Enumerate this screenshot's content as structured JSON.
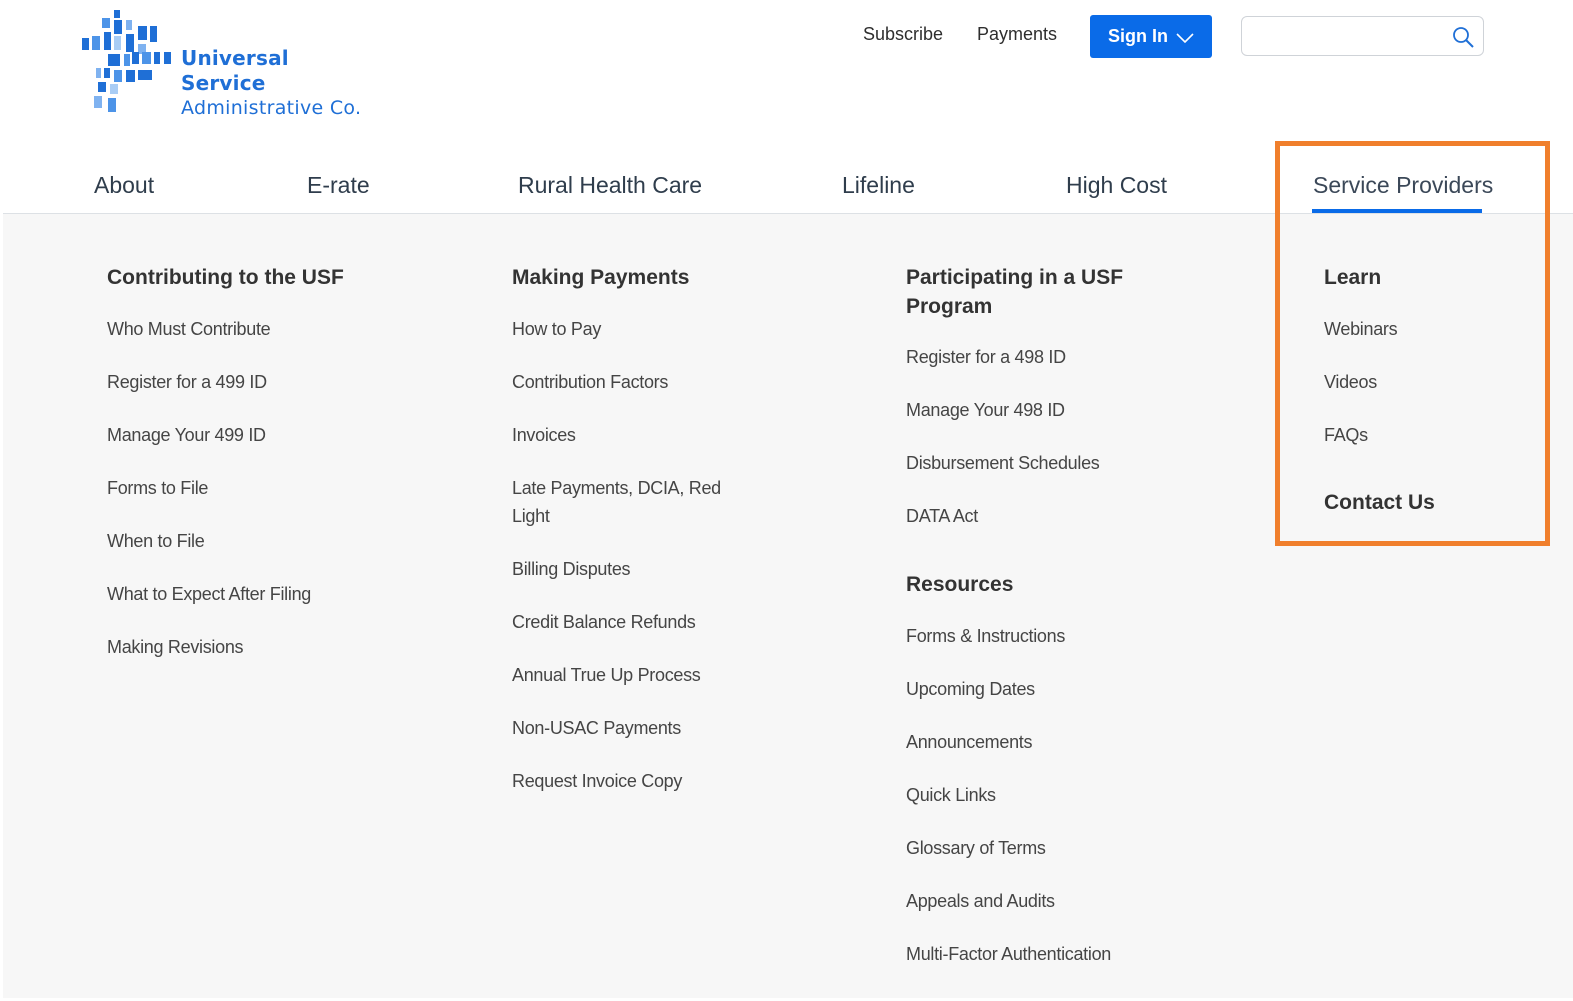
{
  "brand": {
    "name_line1": "Universal Service",
    "name_line2": "Administrative Co.",
    "color": "#1f6fd6"
  },
  "utility_nav": {
    "subscribe": "Subscribe",
    "payments": "Payments",
    "sign_in": "Sign In",
    "search_placeholder": ""
  },
  "main_nav": {
    "items": [
      "About",
      "E-rate",
      "Rural Health Care",
      "Lifeline",
      "High Cost",
      "Service Providers"
    ],
    "active": "Service Providers"
  },
  "mega_menu": {
    "contributing": {
      "heading": "Contributing to the USF",
      "links": [
        "Who Must Contribute",
        "Register for a 499 ID",
        "Manage Your 499 ID",
        "Forms to File",
        "When to File",
        "What to Expect After Filing",
        "Making Revisions"
      ]
    },
    "payments": {
      "heading": "Making Payments",
      "links": [
        "How to Pay",
        "Contribution Factors",
        "Invoices",
        "Late Payments, DCIA, Red",
        "Light",
        "Billing Disputes",
        "Credit Balance Refunds",
        "Annual True Up Process",
        "Non-USAC Payments",
        "Request Invoice Copy"
      ]
    },
    "participating": {
      "heading_line1": "Participating in a USF",
      "heading_line2": "Program",
      "links": [
        "Register for a 498 ID",
        "Manage Your 498 ID",
        "Disbursement Schedules",
        "DATA Act"
      ]
    },
    "resources": {
      "heading": "Resources",
      "links": [
        "Forms & Instructions",
        "Upcoming Dates",
        "Announcements",
        "Quick Links",
        "Glossary of Terms",
        "Appeals and Audits",
        "Multi-Factor Authentication"
      ]
    },
    "learn": {
      "heading": "Learn",
      "links": [
        "Webinars",
        "Videos",
        "FAQs"
      ]
    },
    "contact": {
      "heading": "Contact Us"
    }
  },
  "colors": {
    "accent_blue": "#0a6be8",
    "highlight_orange": "#f07f2c",
    "panel_bg": "#f7f7f7"
  }
}
